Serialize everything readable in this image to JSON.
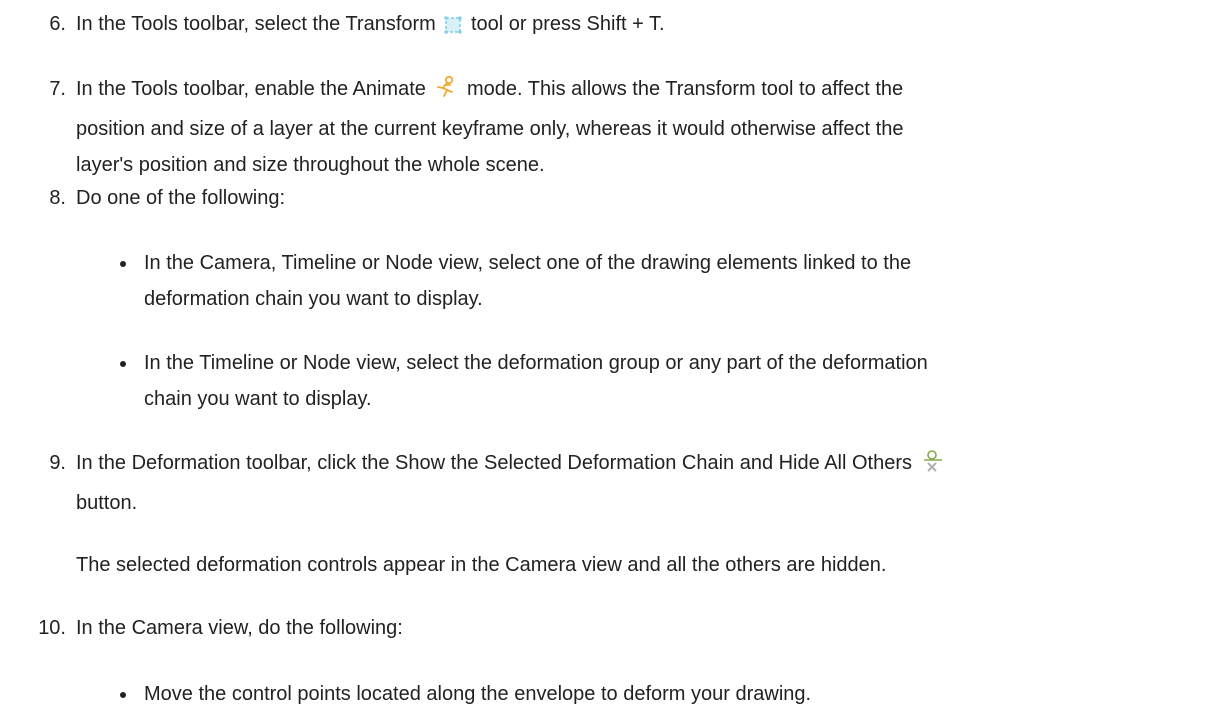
{
  "steps": {
    "s6": {
      "number": "6.",
      "before": "In the Tools toolbar, select the Transform",
      "after": "tool or press Shift + T.",
      "icon": "transform-tool-icon"
    },
    "s7": {
      "number": "7.",
      "before": "In the Tools toolbar, enable the Animate",
      "after": "mode. This allows the Transform tool to affect the",
      "line2": "position and size of a layer at the current keyframe only, whereas it would otherwise affect the",
      "line3": "layer's position and size throughout the whole scene.",
      "icon": "animate-mode-icon"
    },
    "s8": {
      "number": "8.",
      "text": "Do one of the following:",
      "bullets": [
        {
          "line1": "In the Camera, Timeline or Node view, select one of the drawing elements linked to the",
          "line2": "deformation chain you want to display."
        },
        {
          "line1": "In the Timeline or Node view, select the deformation group or any part of the deformation",
          "line2": "chain you want to display."
        }
      ]
    },
    "s9": {
      "number": "9.",
      "before": "In the Deformation toolbar, click the Show the Selected Deformation Chain and Hide All Others",
      "line2": "button.",
      "note": "The selected deformation controls appear in the Camera view and all the others are hidden.",
      "icon": "show-selected-deformation-chain-icon"
    },
    "s10": {
      "number": "10.",
      "text": "In the Camera view, do the following:",
      "bullets": [
        {
          "line1": "Move the control points located along the envelope to deform your drawing."
        }
      ]
    }
  },
  "colors": {
    "text": "#222222",
    "transform_icon": "#7ecbe8",
    "animate_icon": "#f0a830",
    "deform_icon": "#8aa84a"
  }
}
